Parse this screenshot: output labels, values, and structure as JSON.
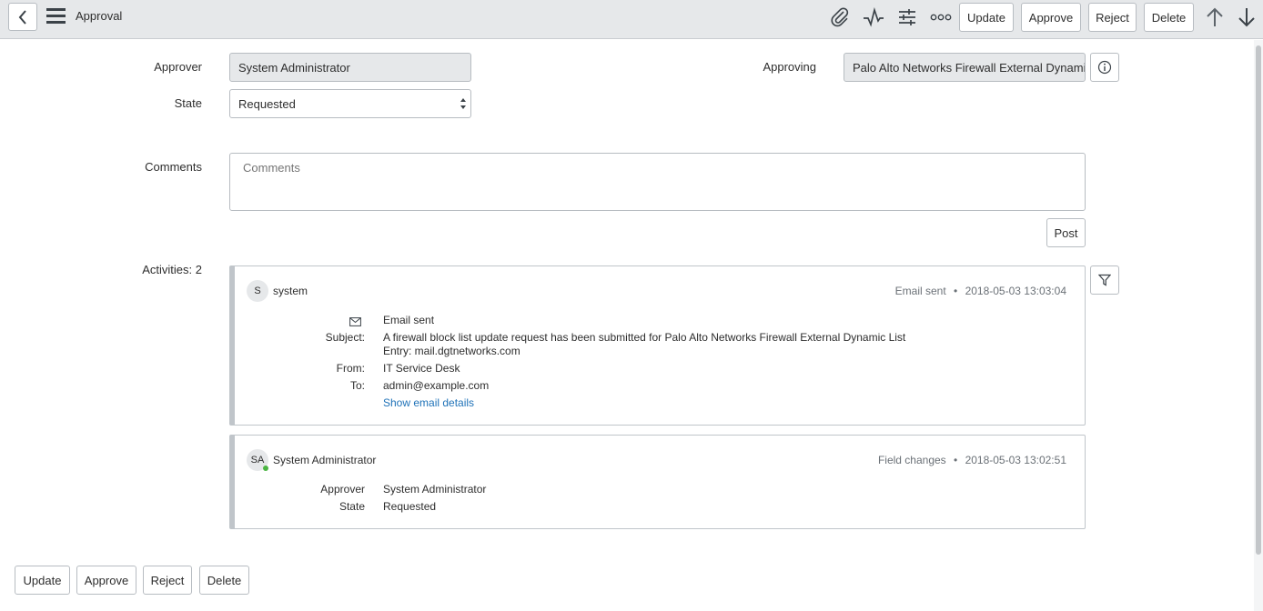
{
  "header": {
    "title": "Approval",
    "buttons": {
      "update": "Update",
      "approve": "Approve",
      "reject": "Reject",
      "delete": "Delete"
    },
    "icons": [
      "back-chevron-icon",
      "hamburger-menu-icon",
      "paperclip-icon",
      "activity-pulse-icon",
      "sliders-icon",
      "more-options-icon",
      "arrow-up-icon",
      "arrow-down-icon"
    ]
  },
  "form": {
    "approver_label": "Approver",
    "approver_value": "System Administrator",
    "state_label": "State",
    "state_value": "Requested",
    "approving_label": "Approving",
    "approving_value": "Palo Alto Networks Firewall External Dynamic List",
    "comments_label": "Comments",
    "comments_placeholder": "Comments",
    "post_button": "Post",
    "activities_label": "Activities: 2"
  },
  "activities": [
    {
      "avatar": "S",
      "user": "system",
      "type": "Email sent",
      "timestamp": "2018-05-03 13:03:04",
      "email_heading": "Email sent",
      "subject_label": "Subject:",
      "subject_line1": "A firewall block list update request has been submitted for Palo Alto Networks Firewall External Dynamic List",
      "subject_line2": "Entry: mail.dgtnetworks.com",
      "from_label": "From:",
      "from_value": "IT Service Desk",
      "to_label": "To:",
      "to_value": "admin@example.com",
      "details_link": "Show email details"
    },
    {
      "avatar": "SA",
      "user": "System Administrator",
      "type": "Field changes",
      "timestamp": "2018-05-03 13:02:51",
      "fields": [
        {
          "label": "Approver",
          "value": "System Administrator"
        },
        {
          "label": "State",
          "value": "Requested"
        }
      ]
    }
  ],
  "footer_buttons": {
    "update": "Update",
    "approve": "Approve",
    "reject": "Reject",
    "delete": "Delete"
  },
  "colors": {
    "header_bg": "#e6e8ea",
    "link": "#1f72b8",
    "online": "#4bb543"
  }
}
